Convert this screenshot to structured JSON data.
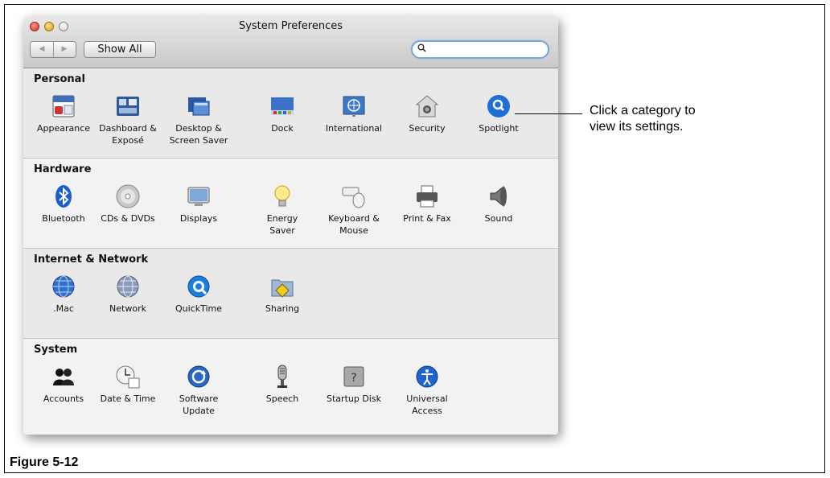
{
  "window": {
    "title": "System Preferences"
  },
  "toolbar": {
    "back_glyph": "◀",
    "forward_glyph": "▶",
    "show_all_label": "Show All",
    "search": {
      "value": "",
      "placeholder": ""
    }
  },
  "sections": [
    {
      "title": "Personal",
      "items": [
        {
          "label": "Appearance",
          "icon": "appearance-icon"
        },
        {
          "label": "Dashboard &\nExposé",
          "icon": "dashboard-icon"
        },
        {
          "label": "Desktop &\nScreen Saver",
          "icon": "desktop-icon"
        },
        {
          "label": "Dock",
          "icon": "dock-icon"
        },
        {
          "label": "International",
          "icon": "international-icon"
        },
        {
          "label": "Security",
          "icon": "security-icon"
        },
        {
          "label": "Spotlight",
          "icon": "spotlight-icon"
        }
      ]
    },
    {
      "title": "Hardware",
      "items": [
        {
          "label": "Bluetooth",
          "icon": "bluetooth-icon"
        },
        {
          "label": "CDs & DVDs",
          "icon": "cd-dvd-icon"
        },
        {
          "label": "Displays",
          "icon": "displays-icon"
        },
        {
          "label": "Energy\nSaver",
          "icon": "energy-saver-icon"
        },
        {
          "label": "Keyboard &\nMouse",
          "icon": "keyboard-mouse-icon"
        },
        {
          "label": "Print & Fax",
          "icon": "printer-icon"
        },
        {
          "label": "Sound",
          "icon": "speaker-icon"
        }
      ]
    },
    {
      "title": "Internet & Network",
      "items": [
        {
          "label": ".Mac",
          "icon": "mac-globe-icon"
        },
        {
          "label": "Network",
          "icon": "network-globe-icon"
        },
        {
          "label": "QuickTime",
          "icon": "quicktime-icon"
        },
        {
          "label": "Sharing",
          "icon": "sharing-folder-icon"
        }
      ]
    },
    {
      "title": "System",
      "items": [
        {
          "label": "Accounts",
          "icon": "accounts-icon"
        },
        {
          "label": "Date & Time",
          "icon": "clock-calendar-icon"
        },
        {
          "label": "Software\nUpdate",
          "icon": "software-update-icon"
        },
        {
          "label": "Speech",
          "icon": "microphone-icon"
        },
        {
          "label": "Startup Disk",
          "icon": "hard-disk-icon"
        },
        {
          "label": "Universal\nAccess",
          "icon": "universal-access-icon"
        }
      ]
    }
  ],
  "callout": {
    "text": "Click a category to\nview its settings."
  },
  "figure": {
    "label": "Figure 5-12"
  },
  "colors": {
    "search_focus": "#7aa6d8",
    "spotlight_blue": "#1e6fd9"
  }
}
